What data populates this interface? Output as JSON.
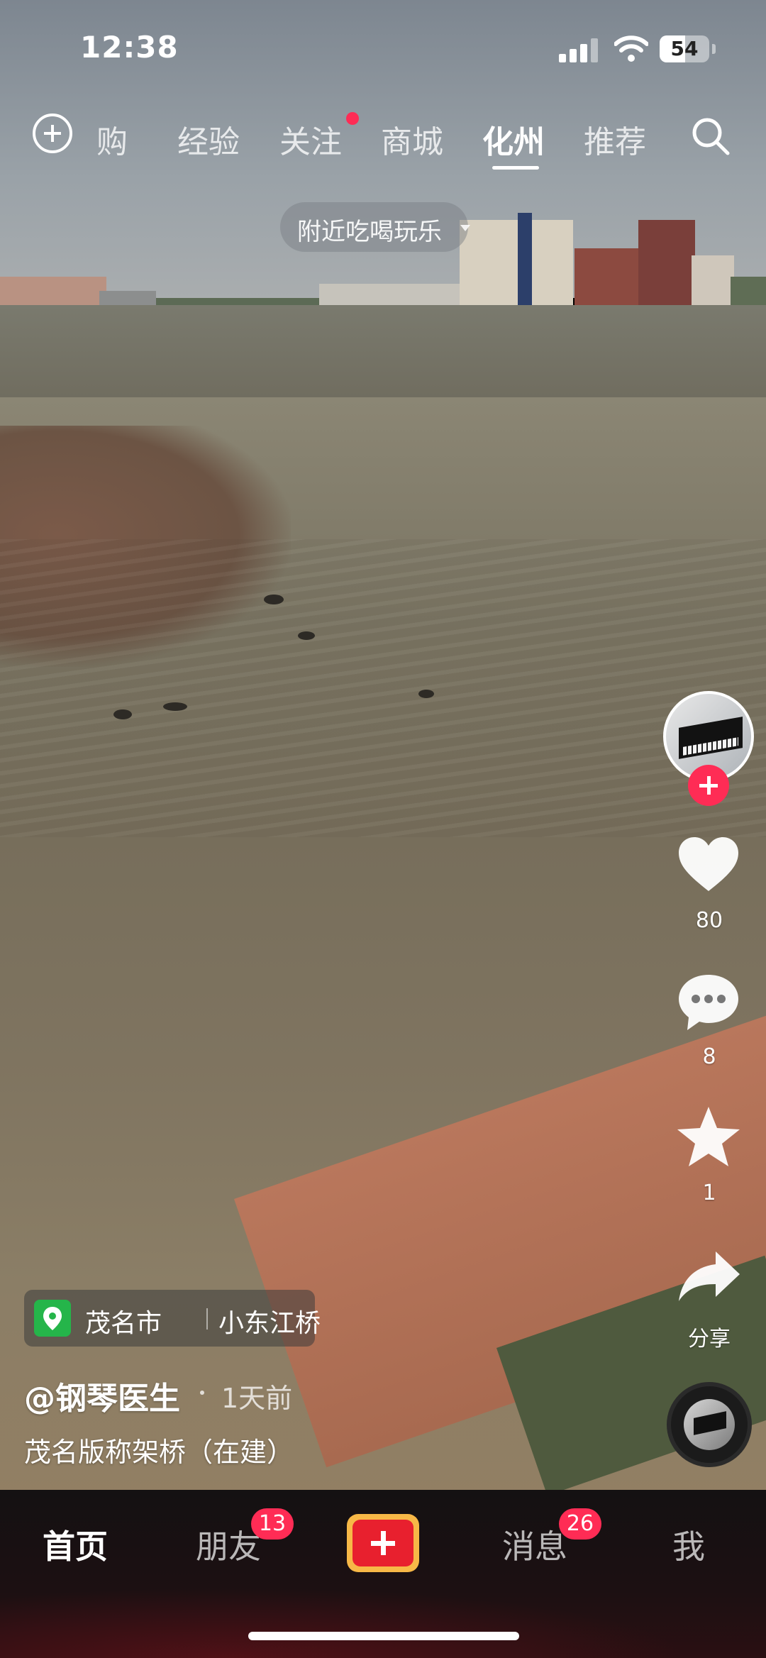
{
  "status_bar": {
    "time": "12:38",
    "battery": "54"
  },
  "top_nav": {
    "tabs": [
      {
        "label": "购"
      },
      {
        "label": "经验"
      },
      {
        "label": "关注"
      },
      {
        "label": "商城"
      },
      {
        "label": "化州"
      },
      {
        "label": "推荐"
      }
    ],
    "active_tab": "化州",
    "nearby_pill": "附近吃喝玩乐"
  },
  "right_rail": {
    "like_count": "80",
    "comment_count": "8",
    "favorite_count": "1",
    "share_label": "分享"
  },
  "caption": {
    "location_city": "茂名市",
    "location_place": "小东江桥",
    "author": "@钢琴医生",
    "time_ago": "1天前",
    "description": "茂名版称架桥（在建）"
  },
  "bottom_tabs": {
    "home": "首页",
    "friends": "朋友",
    "friends_badge": "13",
    "messages": "消息",
    "messages_badge": "26",
    "me": "我"
  },
  "colors": {
    "accent_red": "#ff2c55",
    "create_button_red": "#e8202e",
    "create_button_border": "#f7b847",
    "location_green": "#25b54a"
  }
}
